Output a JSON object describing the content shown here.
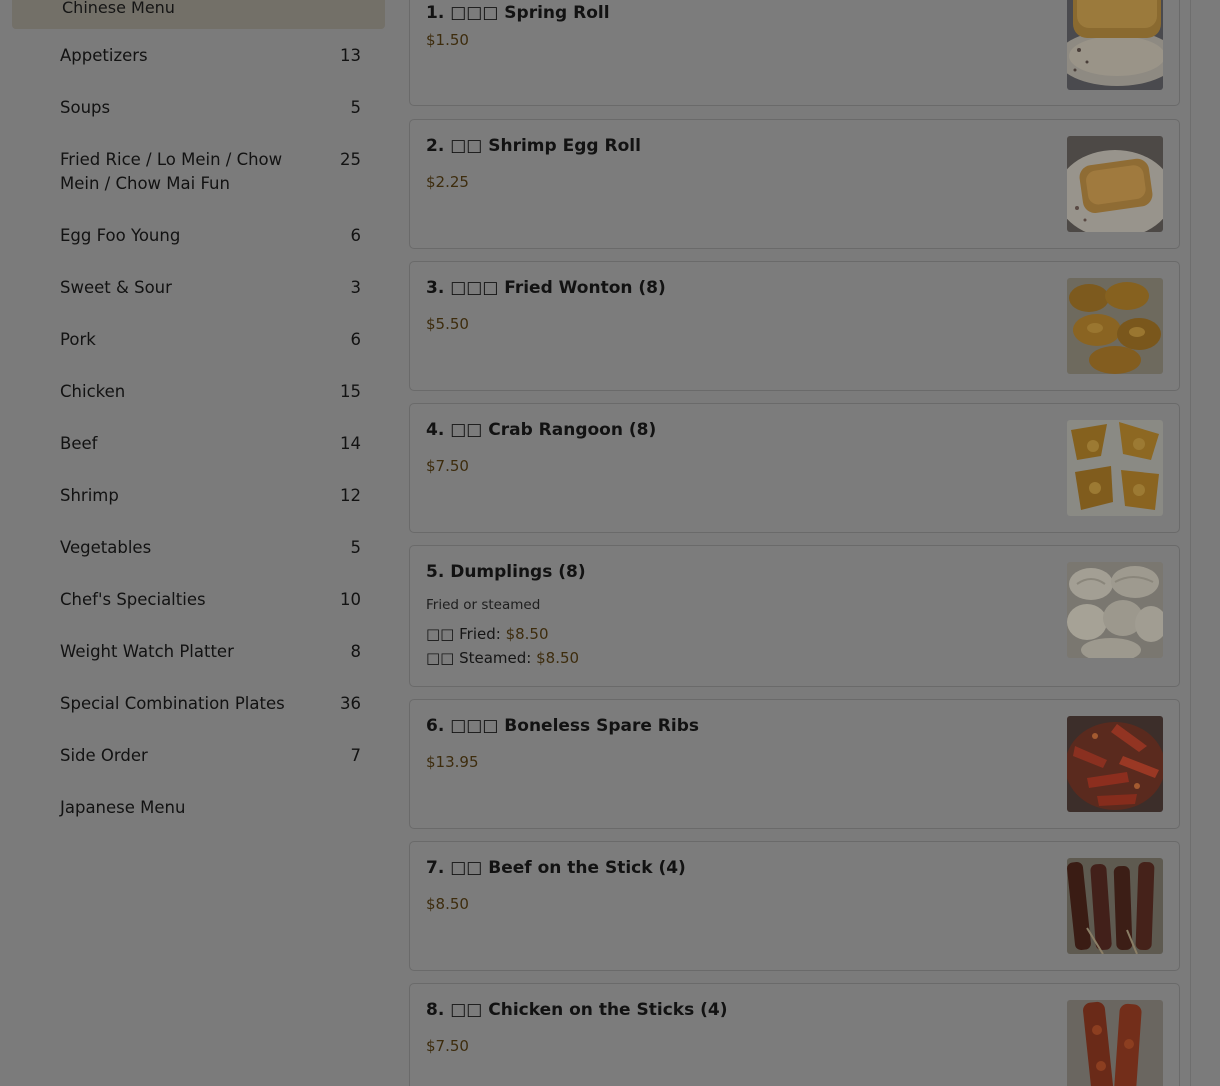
{
  "sidebar": {
    "header": "Chinese Menu",
    "categories": [
      {
        "label": "Appetizers",
        "count": "13"
      },
      {
        "label": "Soups",
        "count": "5"
      },
      {
        "label": "Fried Rice / Lo Mein / Chow Mein / Chow Mai Fun",
        "count": "25"
      },
      {
        "label": "Egg Foo Young",
        "count": "6"
      },
      {
        "label": "Sweet & Sour",
        "count": "3"
      },
      {
        "label": "Pork",
        "count": "6"
      },
      {
        "label": "Chicken",
        "count": "15"
      },
      {
        "label": "Beef",
        "count": "14"
      },
      {
        "label": "Shrimp",
        "count": "12"
      },
      {
        "label": "Vegetables",
        "count": "5"
      },
      {
        "label": "Chef's Specialties",
        "count": "10"
      },
      {
        "label": "Weight Watch Platter",
        "count": "8"
      },
      {
        "label": "Special Combination Plates",
        "count": "36"
      },
      {
        "label": "Side Order",
        "count": "7"
      },
      {
        "label": "Japanese Menu",
        "count": ""
      }
    ]
  },
  "items": [
    {
      "title": "1. □□□ Spring Roll",
      "price": "$1.50",
      "image": "spring-roll-photo"
    },
    {
      "title": "2. □□ Shrimp Egg Roll",
      "price": "$2.25",
      "image": "egg-roll-photo"
    },
    {
      "title": "3. □□□ Fried Wonton (8)",
      "price": "$5.50",
      "image": "fried-wonton-photo"
    },
    {
      "title": "4. □□ Crab Rangoon (8)",
      "price": "$7.50",
      "image": "crab-rangoon-photo"
    },
    {
      "title": "5. Dumplings (8)",
      "description": "Fried or steamed",
      "options": [
        {
          "label": "□□ Fried:",
          "price": "$8.50"
        },
        {
          "label": "□□ Steamed:",
          "price": "$8.50"
        }
      ],
      "image": "dumplings-photo"
    },
    {
      "title": "6. □□□ Boneless Spare Ribs",
      "price": "$13.95",
      "image": "spare-ribs-photo"
    },
    {
      "title": "7. □□ Beef on the Stick (4)",
      "price": "$8.50",
      "image": "beef-stick-photo"
    },
    {
      "title": "8. □□ Chicken on the Sticks (4)",
      "price": "$7.50",
      "image": "chicken-stick-photo"
    }
  ]
}
